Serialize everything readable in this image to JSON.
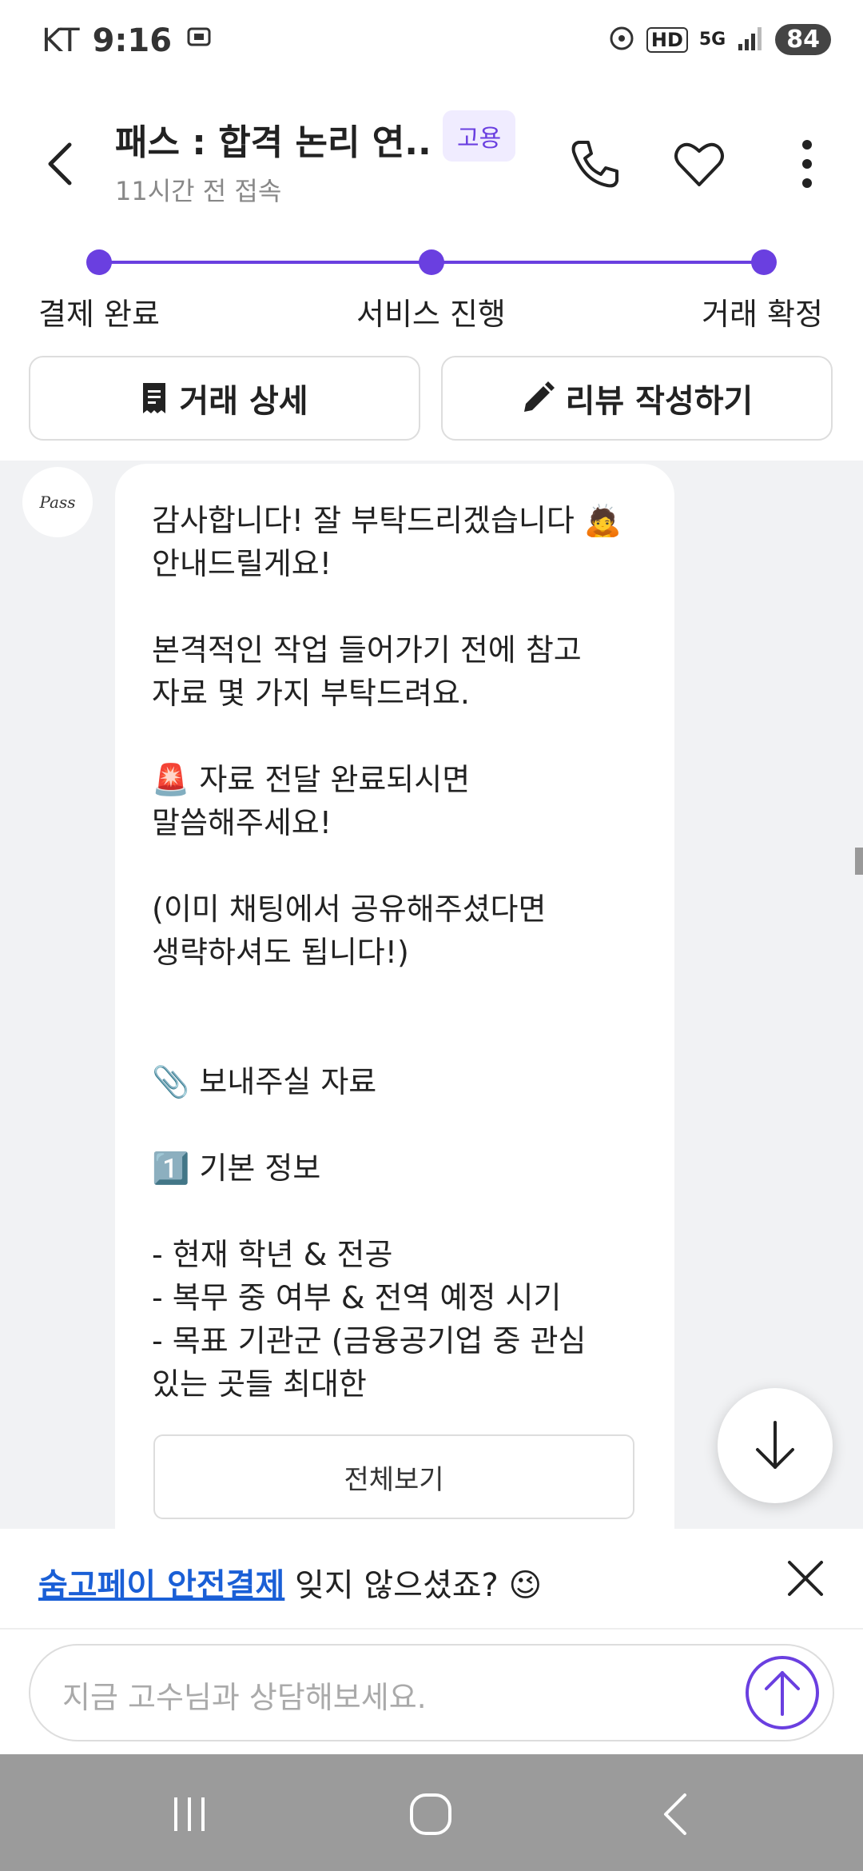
{
  "status_bar": {
    "carrier": "KT",
    "time": "9:16",
    "network": "5G",
    "hd": "HD",
    "battery": "84"
  },
  "header": {
    "title": "패스 : 합격 논리 연...",
    "badge": "고용",
    "subtitle": "11시간 전 접속"
  },
  "progress": {
    "steps": [
      "결제 완료",
      "서비스 진행",
      "거래 확정"
    ],
    "current_step": 3
  },
  "actions": {
    "detail_label": "거래 상세",
    "review_label": "리뷰 작성하기"
  },
  "chat": {
    "avatar_label": "Pass",
    "message": "감사합니다! 잘 부탁드리겠습니다 🙇\n안내드릴게요!\n\n본격적인 작업 들어가기 전에 참고\n자료 몇 가지 부탁드려요.\n\n🚨 자료 전달 완료되시면\n말씀해주세요!\n\n(이미 채팅에서 공유해주셨다면\n생략하셔도 됩니다!)\n\n\n📎 보내주실 자료\n\n1️⃣ 기본 정보\n\n- 현재 학년 & 전공\n- 복무 중 여부 & 전역 예정 시기\n- 목표 기관군 (금융공기업 중 관심\n있는 곳들 최대한",
    "view_all_label": "전체보기"
  },
  "notice": {
    "link_text": "숨고페이 안전결제",
    "text": " 잊지 않으셨죠? 😉"
  },
  "composer": {
    "placeholder": "지금 고수님과 상담해보세요."
  },
  "colors": {
    "accent": "#6a3fe0",
    "link": "#1a5fd6",
    "chat_bg": "#f1f2f4"
  }
}
